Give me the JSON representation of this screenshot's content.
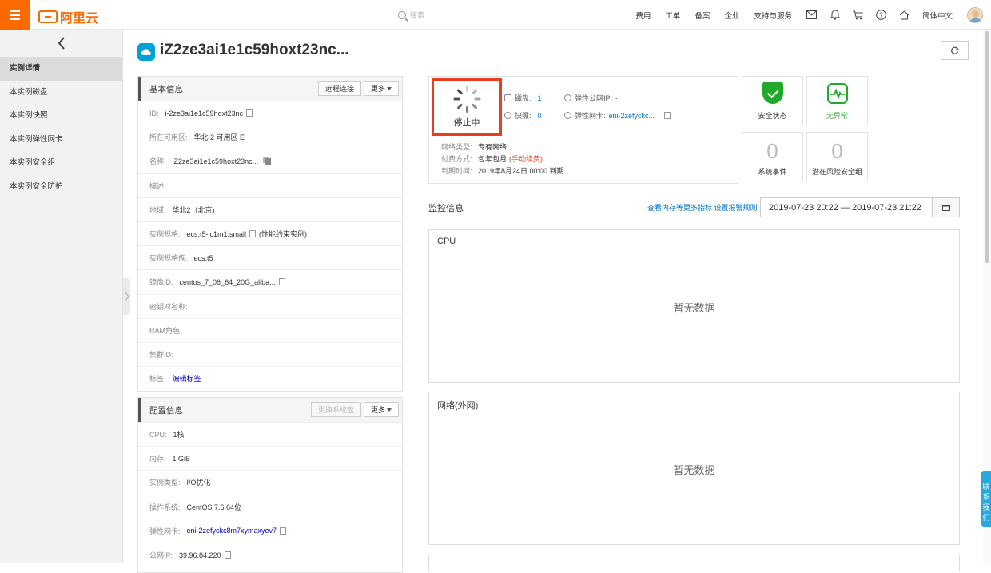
{
  "brand": {
    "logo_text": "阿里云"
  },
  "search": {
    "placeholder": "搜索"
  },
  "topnav": {
    "links": [
      "费用",
      "工单",
      "备案",
      "企业",
      "支持与服务"
    ],
    "language": "简体中文"
  },
  "sidebar": {
    "items": [
      {
        "label": "实例详情",
        "active": true
      },
      {
        "label": "本实例磁盘"
      },
      {
        "label": "本实例快照"
      },
      {
        "label": "本实例弹性网卡"
      },
      {
        "label": "本实例安全组"
      },
      {
        "label": "本实例安全防护"
      }
    ]
  },
  "page": {
    "title": "iZ2ze3ai1e1c59hoxt23nc..."
  },
  "basic": {
    "title": "基本信息",
    "remote_btn": "远程连接",
    "more_btn": "更多",
    "rows": [
      {
        "k": "ID:",
        "v": "i-2ze3ai1e1c59hoxt23nc",
        "copy": true
      },
      {
        "k": "所在可用区:",
        "v": "华北 2 可用区 E"
      },
      {
        "k": "名称:",
        "v": "iZ2ze3ai1e1c59hoxt23nc...",
        "copy2": true
      },
      {
        "k": "描述:",
        "v": ""
      },
      {
        "k": "地域:",
        "v": "华北2（北京)"
      },
      {
        "k": "实例规格:",
        "v": "ecs.t5-lc1m1.small",
        "copy": true,
        "extra": "(性能约束实例)"
      },
      {
        "k": "实例规格族:",
        "v": "ecs.t5"
      },
      {
        "k": "镜像ID:",
        "v": "centos_7_06_64_20G_aliba...",
        "copy": true
      },
      {
        "k": "密钥对名称:",
        "v": ""
      },
      {
        "k": "RAM角色:",
        "v": ""
      },
      {
        "k": "集群ID:",
        "v": ""
      },
      {
        "k": "标签:",
        "v": "编辑标签",
        "link": true
      }
    ]
  },
  "config": {
    "title": "配置信息",
    "change_disk_btn": "更换系统盘",
    "more_btn": "更多",
    "rows": [
      {
        "k": "CPU:",
        "v": "1核"
      },
      {
        "k": "内存:",
        "v": "1 GiB"
      },
      {
        "k": "实例类型:",
        "v": "I/O优化"
      },
      {
        "k": "操作系统:",
        "v": "CentOS 7.6 64位"
      },
      {
        "k": "弹性网卡:",
        "v": "eni-2zefyckc8m7xymaxyev7",
        "link": true,
        "copy": true
      },
      {
        "k": "公网IP:",
        "v": "39.96.84.220",
        "copy": true
      }
    ]
  },
  "status": {
    "state": "停止中",
    "disk_k": "磁盘:",
    "disk_v": "1",
    "snap_k": "快照:",
    "snap_v": "0",
    "eip_k": "弹性公网IP:",
    "eip_v": "-",
    "eni_k": "弹性网卡:",
    "eni_v": "eni-2zefyckc...",
    "net_k": "网络类型:",
    "net_v": "专有网络",
    "pay_k": "付费方式:",
    "pay_v": "包年包月",
    "pay_warn": "(手动续费)",
    "exp_k": "到期时间:",
    "exp_v": "2019年8月24日 00:00 到期"
  },
  "tiles": {
    "security": "安全状态",
    "anomaly": "无异常",
    "events_count": "0",
    "events": "系统事件",
    "risk_count": "0",
    "risk": "潜在风险安全组"
  },
  "monitor": {
    "title": "监控信息",
    "links": "查看内存等更多指标 设置报警规则",
    "date_range": "2019-07-23 20:22  —  2019-07-23 21:22",
    "charts": [
      {
        "title": "CPU",
        "empty": "暂无数据"
      },
      {
        "title": "网络(外网)",
        "empty": "暂无数据"
      }
    ]
  },
  "contact": "联系我们",
  "colors": {
    "accent": "#ff6a00",
    "link": "#0070cc",
    "danger": "#e5401e",
    "ok": "#20a92a"
  }
}
